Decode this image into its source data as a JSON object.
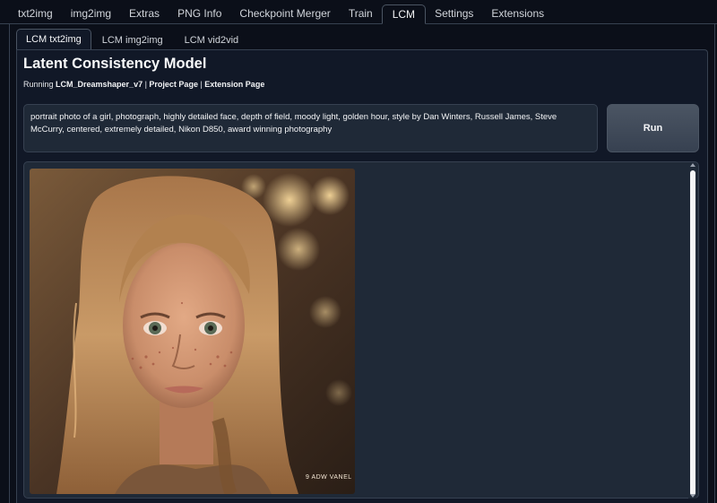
{
  "top_tabs": [
    {
      "label": "txt2img"
    },
    {
      "label": "img2img"
    },
    {
      "label": "Extras"
    },
    {
      "label": "PNG Info"
    },
    {
      "label": "Checkpoint Merger"
    },
    {
      "label": "Train"
    },
    {
      "label": "LCM",
      "active": true
    },
    {
      "label": "Settings"
    },
    {
      "label": "Extensions"
    }
  ],
  "sub_tabs": [
    {
      "label": "LCM txt2img",
      "active": true
    },
    {
      "label": "LCM img2img"
    },
    {
      "label": "LCM vid2vid"
    }
  ],
  "main": {
    "title": "Latent Consistency Model",
    "running_prefix": "Running ",
    "model_name": "LCM_Dreamshaper_v7",
    "separator": " | ",
    "project_link": "Project Page",
    "extension_link": "Extension Page",
    "prompt": "portrait photo of a girl, photograph, highly detailed face, depth of field, moody light, golden hour, style by Dan Winters, Russell James, Steve McCurry, centered, extremely detailed, Nikon D850, award winning photography",
    "run_label": "Run"
  },
  "gallery": {
    "image_icon": "portrait-photo-image"
  },
  "colors": {
    "background": "#0b0f19",
    "panel": "#111827",
    "input": "#1f2937",
    "border": "#374151",
    "button": "#4b5563"
  }
}
